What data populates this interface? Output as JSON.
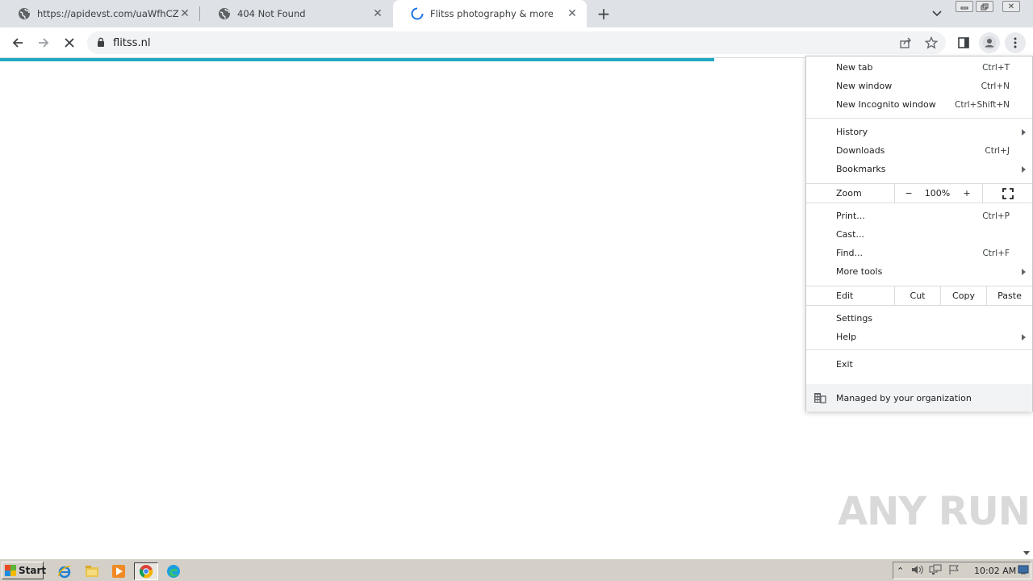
{
  "tabs": [
    {
      "title": "https://apidevst.com/uaWfhCZHOIF",
      "active": false
    },
    {
      "title": "404 Not Found",
      "active": false
    },
    {
      "title": "Flitss photography & more",
      "active": true
    }
  ],
  "toolbar": {
    "url": "flitss.nl"
  },
  "menu": {
    "items": [
      {
        "label": "New tab",
        "shortcut": "Ctrl+T"
      },
      {
        "label": "New window",
        "shortcut": "Ctrl+N"
      },
      {
        "label": "New Incognito window",
        "shortcut": "Ctrl+Shift+N"
      },
      {
        "label": "History",
        "shortcut": ""
      },
      {
        "label": "Downloads",
        "shortcut": "Ctrl+J"
      },
      {
        "label": "Bookmarks",
        "shortcut": ""
      },
      {
        "label": "Print...",
        "shortcut": "Ctrl+P"
      },
      {
        "label": "Cast...",
        "shortcut": ""
      },
      {
        "label": "Find...",
        "shortcut": "Ctrl+F"
      },
      {
        "label": "More tools",
        "shortcut": ""
      },
      {
        "label": "Settings",
        "shortcut": ""
      },
      {
        "label": "Help",
        "shortcut": ""
      },
      {
        "label": "Exit",
        "shortcut": ""
      }
    ],
    "zoom": {
      "label": "Zoom",
      "minus": "−",
      "value": "100%",
      "plus": "+"
    },
    "edit": {
      "label": "Edit",
      "cut": "Cut",
      "copy": "Copy",
      "paste": "Paste"
    },
    "managed": "Managed by your organization"
  },
  "watermark": "ANY RUN",
  "taskbar": {
    "start": "Start",
    "clock": "10:02 AM"
  },
  "colors": {
    "progress": "#1fa7c4",
    "tabstrip": "#dee1e6"
  }
}
